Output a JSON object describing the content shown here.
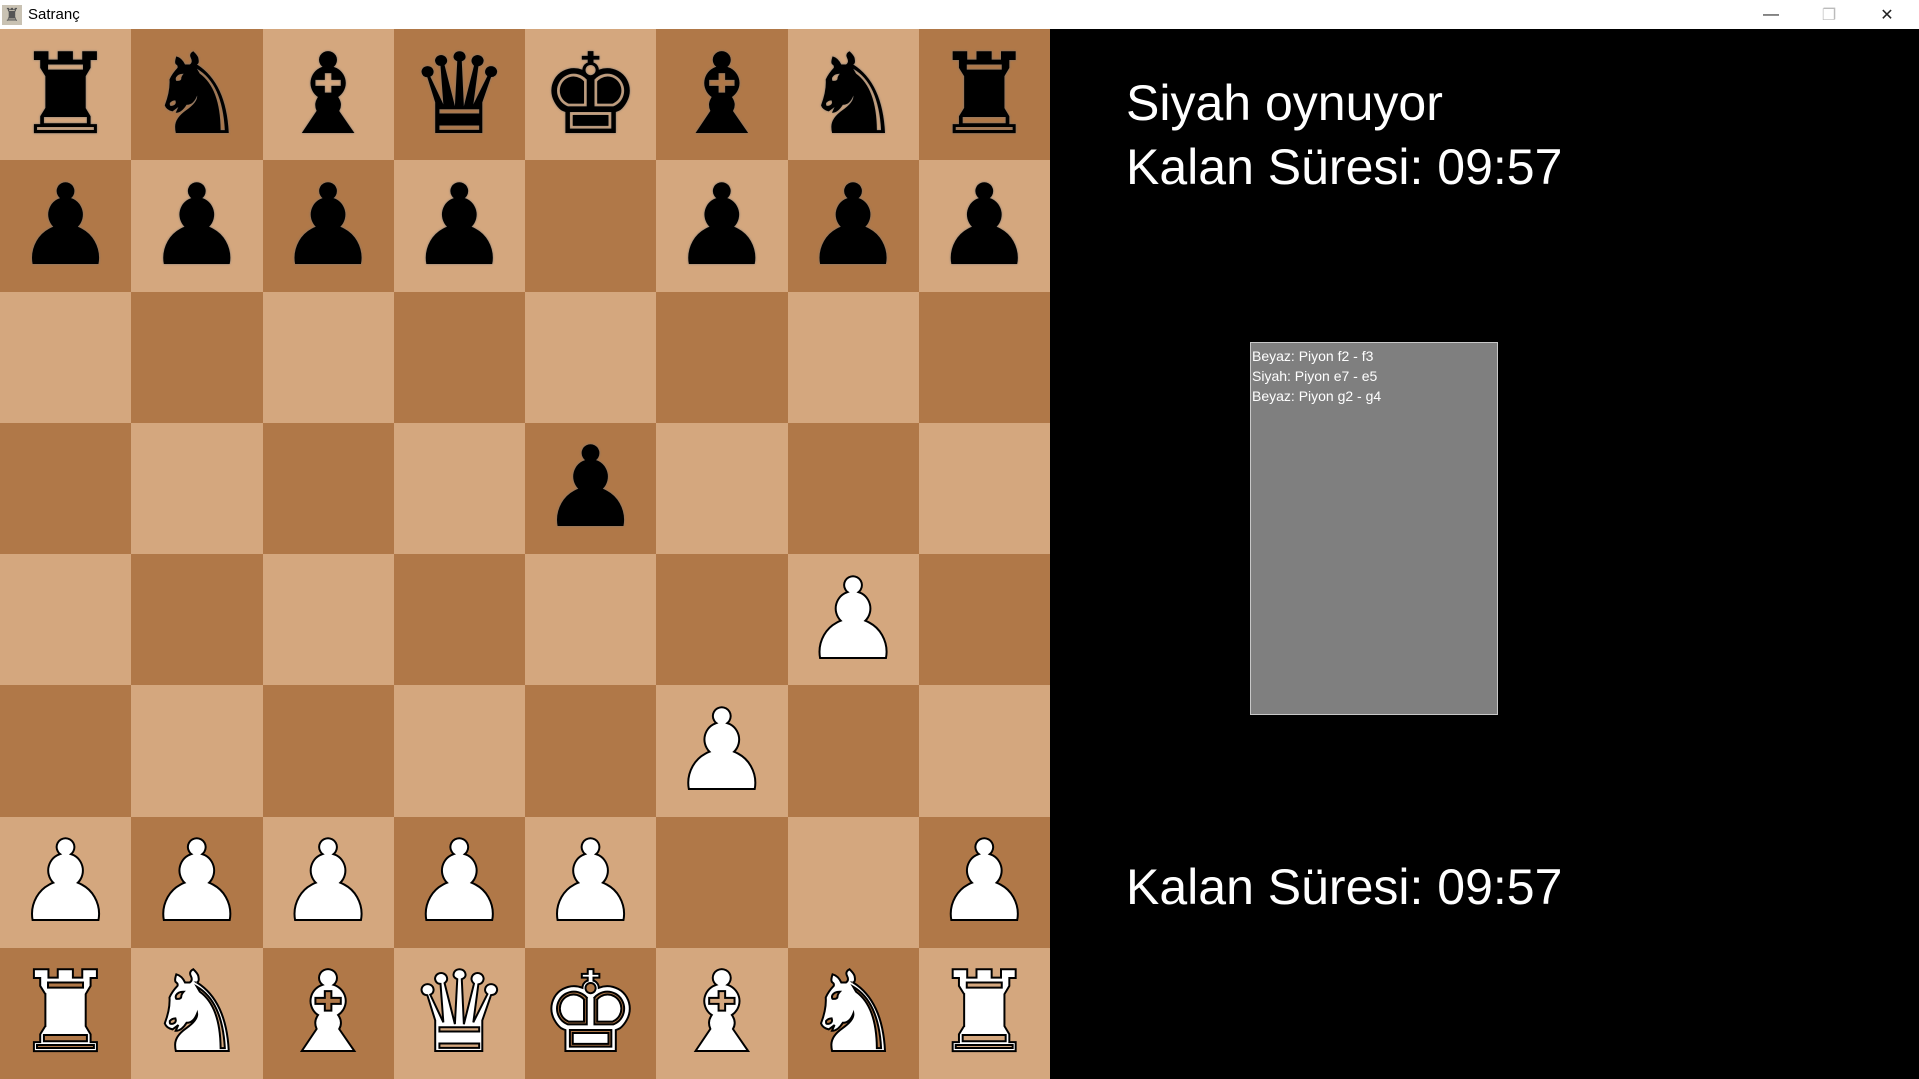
{
  "window": {
    "title": "Satranç",
    "icon": "chess-board-icon",
    "controls": [
      "minimize-icon",
      "maximize-icon",
      "close-icon"
    ]
  },
  "colors": {
    "light_square": "#d4a77e",
    "dark_square": "#b07848",
    "background": "#000000",
    "log_background": "#7f7f7f"
  },
  "board": {
    "ranks": [
      [
        {
          "piece": "rook",
          "color": "black",
          "glyph": "♜"
        },
        {
          "piece": "knight",
          "color": "black",
          "glyph": "♞"
        },
        {
          "piece": "bishop",
          "color": "black",
          "glyph": "♝"
        },
        {
          "piece": "queen",
          "color": "black",
          "glyph": "♛"
        },
        {
          "piece": "king",
          "color": "black",
          "glyph": "♚"
        },
        {
          "piece": "bishop",
          "color": "black",
          "glyph": "♝"
        },
        {
          "piece": "knight",
          "color": "black",
          "glyph": "♞"
        },
        {
          "piece": "rook",
          "color": "black",
          "glyph": "♜"
        }
      ],
      [
        {
          "piece": "pawn",
          "color": "black",
          "glyph": "♟"
        },
        {
          "piece": "pawn",
          "color": "black",
          "glyph": "♟"
        },
        {
          "piece": "pawn",
          "color": "black",
          "glyph": "♟"
        },
        {
          "piece": "pawn",
          "color": "black",
          "glyph": "♟"
        },
        null,
        {
          "piece": "pawn",
          "color": "black",
          "glyph": "♟"
        },
        {
          "piece": "pawn",
          "color": "black",
          "glyph": "♟"
        },
        {
          "piece": "pawn",
          "color": "black",
          "glyph": "♟"
        }
      ],
      [
        null,
        null,
        null,
        null,
        null,
        null,
        null,
        null
      ],
      [
        null,
        null,
        null,
        null,
        {
          "piece": "pawn",
          "color": "black",
          "glyph": "♟"
        },
        null,
        null,
        null
      ],
      [
        null,
        null,
        null,
        null,
        null,
        null,
        {
          "piece": "pawn",
          "color": "white",
          "glyph": "♟"
        },
        null
      ],
      [
        null,
        null,
        null,
        null,
        null,
        {
          "piece": "pawn",
          "color": "white",
          "glyph": "♟"
        },
        null,
        null
      ],
      [
        {
          "piece": "pawn",
          "color": "white",
          "glyph": "♟"
        },
        {
          "piece": "pawn",
          "color": "white",
          "glyph": "♟"
        },
        {
          "piece": "pawn",
          "color": "white",
          "glyph": "♟"
        },
        {
          "piece": "pawn",
          "color": "white",
          "glyph": "♟"
        },
        {
          "piece": "pawn",
          "color": "white",
          "glyph": "♟"
        },
        null,
        null,
        {
          "piece": "pawn",
          "color": "white",
          "glyph": "♟"
        }
      ],
      [
        {
          "piece": "rook",
          "color": "white",
          "glyph": "♜"
        },
        {
          "piece": "knight",
          "color": "white",
          "glyph": "♞"
        },
        {
          "piece": "bishop",
          "color": "white",
          "glyph": "♝"
        },
        {
          "piece": "queen",
          "color": "white",
          "glyph": "♛"
        },
        {
          "piece": "king",
          "color": "white",
          "glyph": "♚"
        },
        {
          "piece": "bishop",
          "color": "white",
          "glyph": "♝"
        },
        {
          "piece": "knight",
          "color": "white",
          "glyph": "♞"
        },
        {
          "piece": "rook",
          "color": "white",
          "glyph": "♜"
        }
      ]
    ]
  },
  "status": {
    "turn_text": "Siyah oynuyor",
    "black_timer": "Kalan Süresi: 09:57",
    "white_timer": "Kalan Süresi: 09:57"
  },
  "move_log": [
    "Beyaz: Piyon f2 - f3",
    "Siyah: Piyon e7 - e5",
    "Beyaz: Piyon g2 - g4"
  ]
}
